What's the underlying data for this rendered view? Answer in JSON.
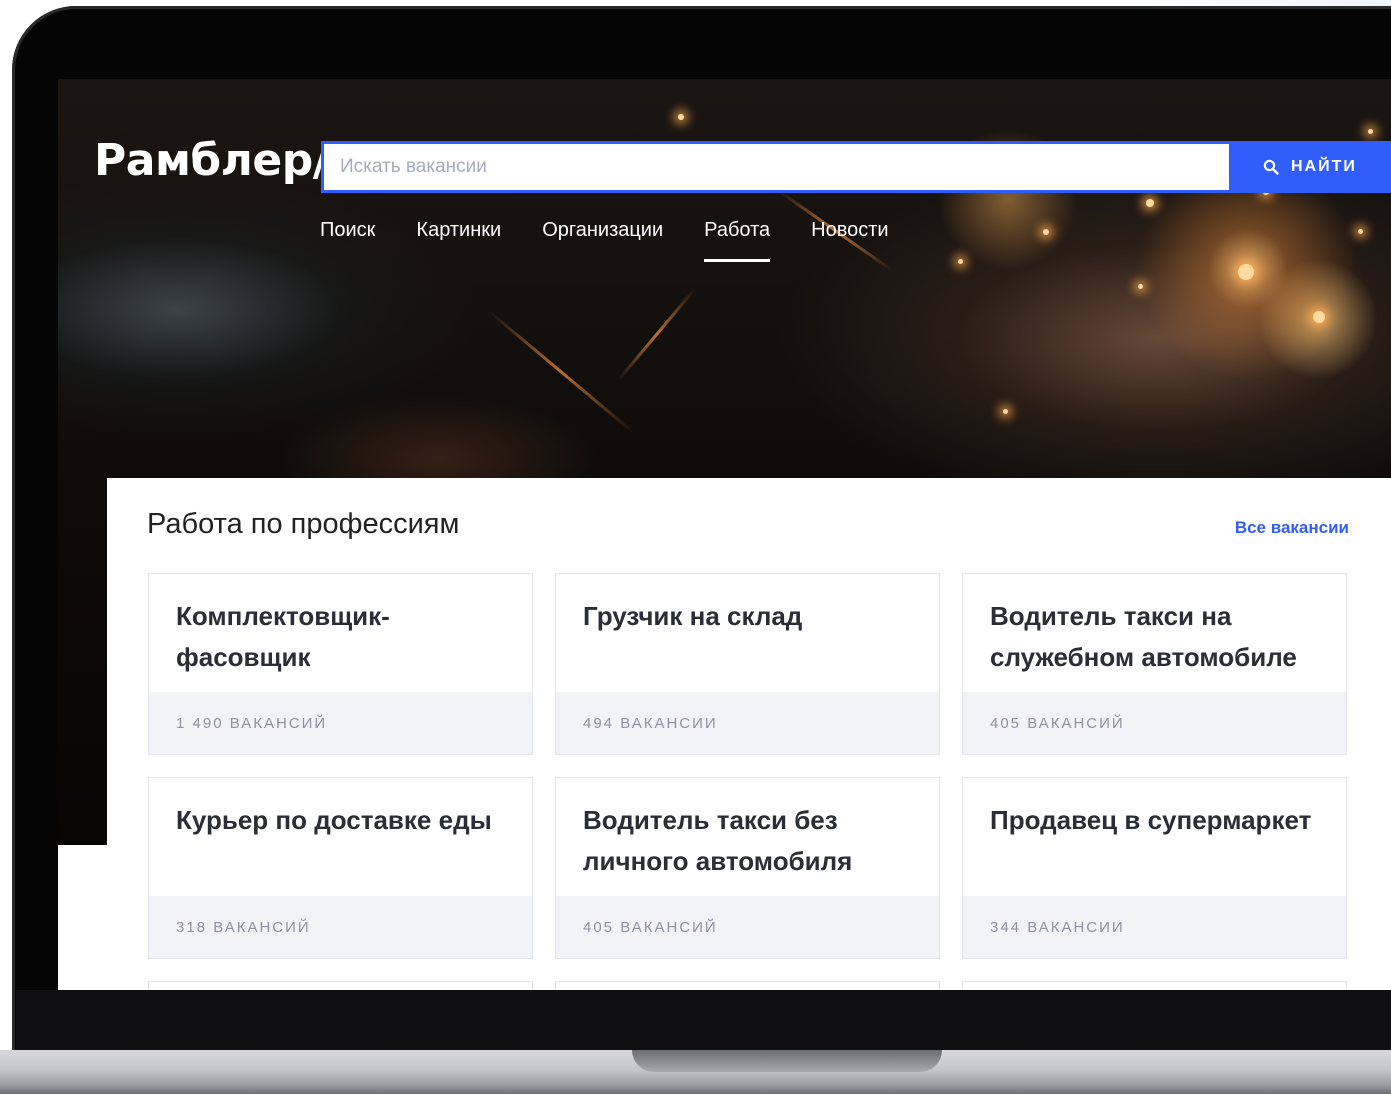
{
  "header": {
    "logo": "Рамблер/",
    "search_placeholder": "Искать вакансии",
    "search_button": "НАЙТИ",
    "search_icon": "magnifier-icon"
  },
  "nav": {
    "items": [
      {
        "label": "Поиск",
        "active": false
      },
      {
        "label": "Картинки",
        "active": false
      },
      {
        "label": "Организации",
        "active": false
      },
      {
        "label": "Работа",
        "active": true
      },
      {
        "label": "Новости",
        "active": false
      }
    ]
  },
  "section": {
    "title": "Работа по профессиям",
    "all_link": "Все вакансии"
  },
  "cards": [
    {
      "title": "Комплектовщик-фасовщик",
      "count": "1 490 ВАКАНСИЙ"
    },
    {
      "title": "Грузчик на склад",
      "count": "494 ВАКАНСИИ"
    },
    {
      "title": "Водитель такси на служебном автомобиле",
      "count": "405 ВАКАНСИЙ"
    },
    {
      "title": "Курьер по доставке еды",
      "count": "318 ВАКАНСИЙ"
    },
    {
      "title": "Водитель такси без личного автомобиля",
      "count": "405 ВАКАНСИЙ"
    },
    {
      "title": "Продавец в супермаркет",
      "count": "344 ВАКАНСИИ"
    }
  ],
  "colors": {
    "accent": "#315efb",
    "card_footer_bg": "#f2f3f7",
    "count_text": "#8d93a3"
  }
}
